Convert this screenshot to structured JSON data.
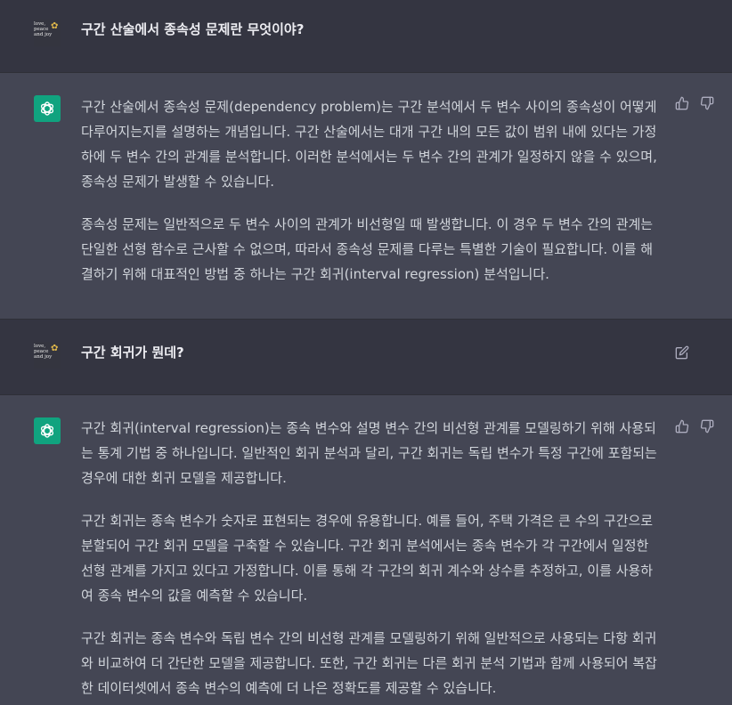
{
  "user_avatar": {
    "text": "love,\npeace\nand joy",
    "mark": "✿"
  },
  "conversation": [
    {
      "role": "user",
      "text": "구간 산술에서 종속성 문제란 무엇이야?"
    },
    {
      "role": "assistant",
      "paragraphs": [
        "구간 산술에서 종속성 문제(dependency problem)는 구간 분석에서 두 변수 사이의 종속성이 어떻게\n다루어지는지를 설명하는 개념입니다. 구간 산술에서는 대개 구간 내의 모든 값이 범위 내에 있다는 가정\n하에 두 변수 간의 관계를 분석합니다. 이러한 분석에서는 두 변수 간의 관계가 일정하지 않을 수 있으며,\n종속성 문제가 발생할 수 있습니다.",
        "종속성 문제는 일반적으로 두 변수 사이의 관계가 비선형일 때 발생합니다. 이 경우 두 변수 간의 관계는\n단일한 선형 함수로 근사할 수 없으며, 따라서 종속성 문제를 다루는 특별한 기술이 필요합니다. 이를 해\n결하기 위해 대표적인 방법 중 하나는 구간 회귀(interval regression) 분석입니다."
      ]
    },
    {
      "role": "user",
      "text": "구간 회귀가 뭔데?"
    },
    {
      "role": "assistant",
      "paragraphs": [
        "구간 회귀(interval regression)는 종속 변수와 설명 변수 간의 비선형 관계를 모델링하기 위해 사용되\n는 통계 기법 중 하나입니다. 일반적인 회귀 분석과 달리, 구간 회귀는 독립 변수가 특정 구간에 포함되는\n경우에 대한 회귀 모델을 제공합니다.",
        "구간 회귀는 종속 변수가 숫자로 표현되는 경우에 유용합니다. 예를 들어, 주택 가격은 큰 수의 구간으로\n분할되어 구간 회귀 모델을 구축할 수 있습니다. 구간 회귀 분석에서는 종속 변수가 각 구간에서 일정한\n선형 관계를 가지고 있다고 가정합니다. 이를 통해 각 구간의 회귀 계수와 상수를 추정하고, 이를 사용하\n여 종속 변수의 값을 예측할 수 있습니다.",
        "구간 회귀는 종속 변수와 독립 변수 간의 비선형 관계를 모델링하기 위해 일반적으로 사용되는 다항 회귀\n와 비교하여 더 간단한 모델을 제공합니다. 또한, 구간 회귀는 다른 회귀 분석 기법과 함께 사용되어 복잡\n한 데이터셋에서 종속 변수의 예측에 더 나은 정확도를 제공할 수 있습니다."
      ]
    }
  ],
  "icons": {
    "thumbs_up": "thumbs-up-icon",
    "thumbs_down": "thumbs-down-icon",
    "edit": "edit-icon",
    "bot_logo": "openai-logo-icon"
  },
  "colors": {
    "user_bg": "#343541",
    "assistant_bg": "#444654",
    "bot_avatar": "#10a37f",
    "text": "#d1d5db",
    "user_text": "#ececf1"
  }
}
